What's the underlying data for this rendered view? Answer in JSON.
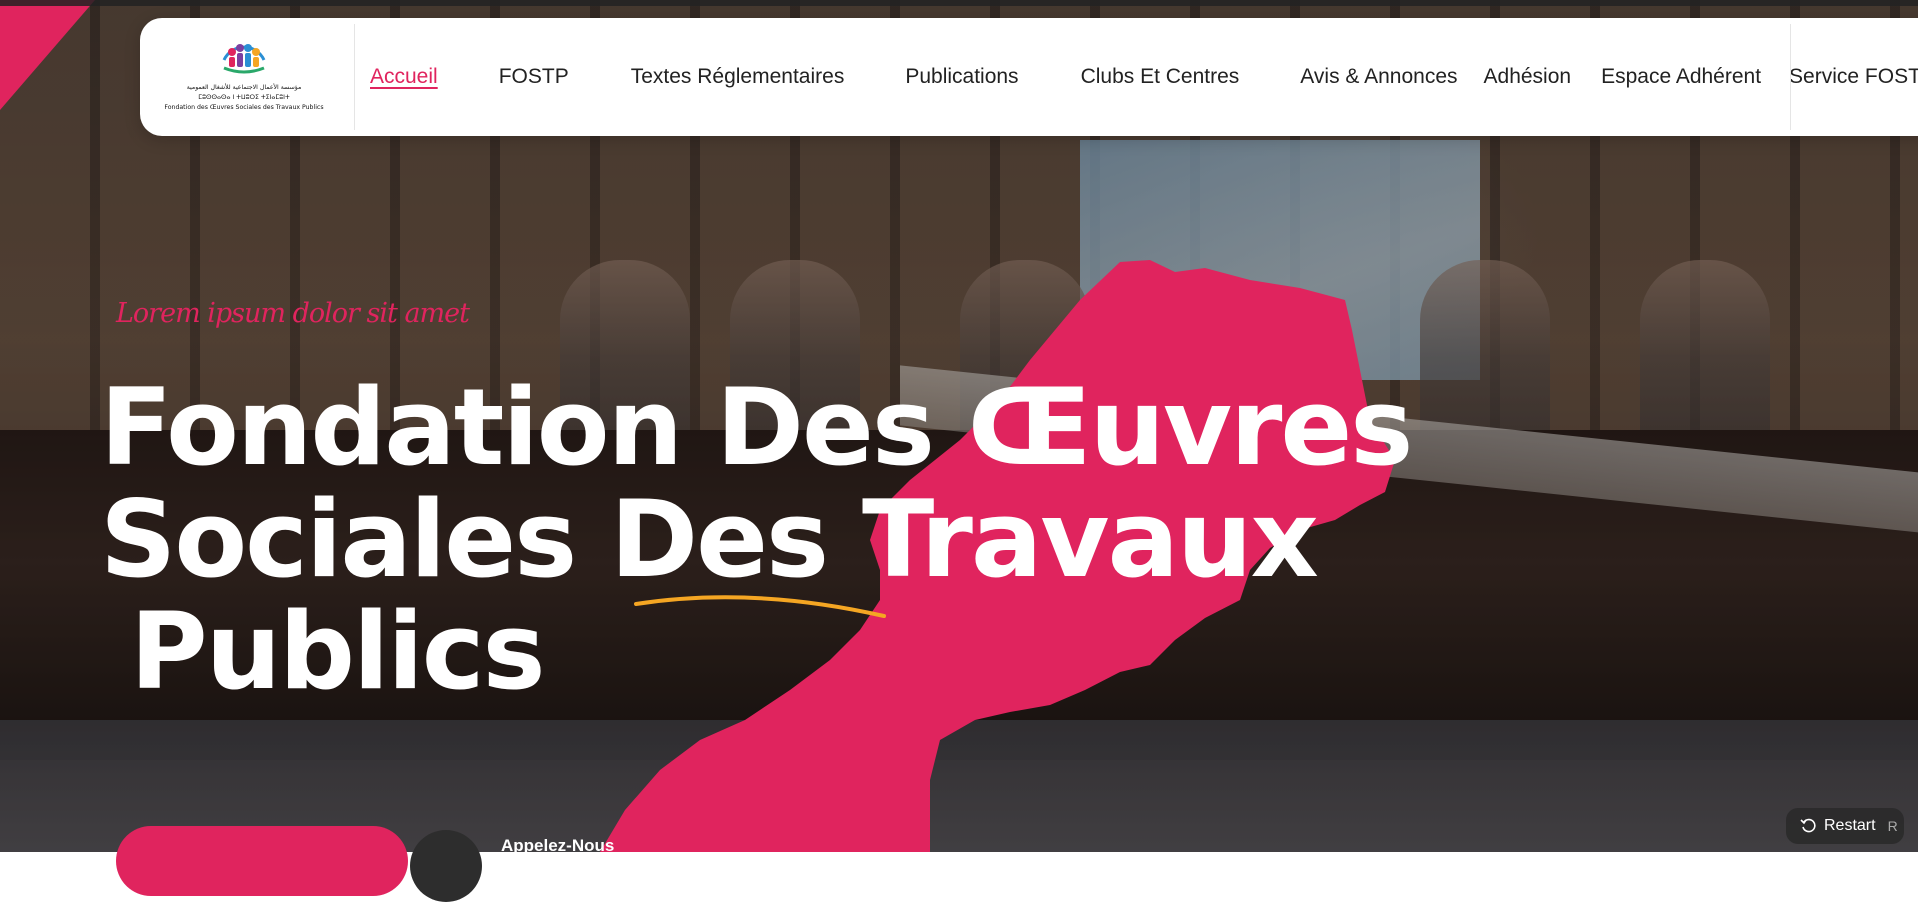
{
  "colors": {
    "accent": "#e0245e",
    "text_dark": "#222222",
    "highlight": "#f5a623"
  },
  "logo": {
    "arabic": "مؤسسة الأعمال الاجتماعية للأشغال العمومية",
    "tifinagh": "ⵎⵓⵙⵙⴰⵙⴰ ⵏ ⵜⵡⵓⵔⵉ ⵜⵉⵏⴰⵎⵓⵏⵜ",
    "french": "Fondation des Œuvres Sociales des Travaux Publics"
  },
  "nav": {
    "items": [
      {
        "label": "Accueil",
        "active": true
      },
      {
        "label": "FOSTP",
        "active": false
      },
      {
        "label": "Textes Réglementaires",
        "active": false
      },
      {
        "label": "Publications",
        "active": false
      },
      {
        "label": "Clubs Et Centres",
        "active": false
      },
      {
        "label": "Avis & Annonces",
        "active": false
      },
      {
        "label": "Adhésion",
        "active": false
      },
      {
        "label": "Espace Adhérent",
        "active": false
      },
      {
        "label": "Service FOSTP",
        "active": false
      }
    ]
  },
  "hero": {
    "tagline": "Lorem ipsum dolor sit amet",
    "title_line1": "Fondation Des Œuvres",
    "title_line2": "Sociales Des Travaux",
    "title_line3": "Publics",
    "call_label": "Appelez-Nous"
  },
  "restart": {
    "label": "Restart",
    "shortcut": "R",
    "icon": "restart-icon"
  }
}
